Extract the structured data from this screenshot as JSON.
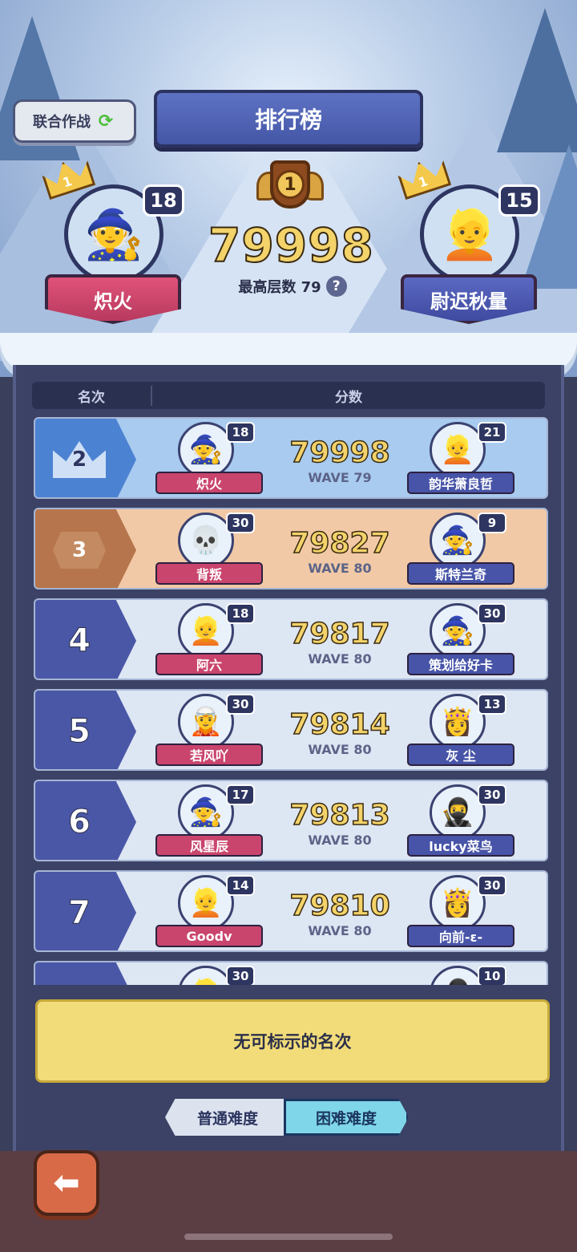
{
  "header": {
    "coop_label": "联合作战",
    "title": "排行榜"
  },
  "top": {
    "rank": "1",
    "score": "79998",
    "floor_label": "最高层数 79",
    "left": {
      "name": "炽火",
      "level": "18",
      "crown": "1",
      "avatar": "🧙"
    },
    "right": {
      "name": "尉迟秋量",
      "level": "15",
      "crown": "1",
      "avatar": "👱"
    }
  },
  "table": {
    "col_rank": "名次",
    "col_score": "分数",
    "rows": [
      {
        "rank": "2",
        "score": "79998",
        "wave": "WAVE 79",
        "p1": {
          "name": "炽火",
          "level": "18",
          "avatar": "🧙"
        },
        "p2": {
          "name": "韵华萧良哲",
          "level": "21",
          "avatar": "👱"
        }
      },
      {
        "rank": "3",
        "score": "79827",
        "wave": "WAVE 80",
        "p1": {
          "name": "背叛",
          "level": "30",
          "avatar": "💀"
        },
        "p2": {
          "name": "斯特兰奇",
          "level": "9",
          "avatar": "🧙"
        }
      },
      {
        "rank": "4",
        "score": "79817",
        "wave": "WAVE 80",
        "p1": {
          "name": "阿六",
          "level": "18",
          "avatar": "👱"
        },
        "p2": {
          "name": "策划给好卡",
          "level": "30",
          "avatar": "🧙"
        }
      },
      {
        "rank": "5",
        "score": "79814",
        "wave": "WAVE 80",
        "p1": {
          "name": "若风吖",
          "level": "30",
          "avatar": "🧝"
        },
        "p2": {
          "name": "灰 尘",
          "level": "13",
          "avatar": "👸"
        }
      },
      {
        "rank": "6",
        "score": "79813",
        "wave": "WAVE 80",
        "p1": {
          "name": "风星辰",
          "level": "17",
          "avatar": "🧙"
        },
        "p2": {
          "name": "lucky菜鸟",
          "level": "30",
          "avatar": "🥷"
        }
      },
      {
        "rank": "7",
        "score": "79810",
        "wave": "WAVE 80",
        "p1": {
          "name": "Goodv",
          "level": "14",
          "avatar": "👱"
        },
        "p2": {
          "name": "向前-ε-",
          "level": "30",
          "avatar": "👸"
        }
      },
      {
        "rank": "",
        "score": "",
        "wave": "",
        "p1": {
          "name": "",
          "level": "30",
          "avatar": "👱"
        },
        "p2": {
          "name": "",
          "level": "10",
          "avatar": "🥷"
        }
      }
    ]
  },
  "my_rank": "无可标示的名次",
  "difficulty": {
    "normal": "普通难度",
    "hard": "困难难度",
    "selected": "hard"
  },
  "icons": {
    "back": "back-arrow-icon",
    "help": "question-icon",
    "refresh": "refresh-icon"
  },
  "colors": {
    "accent_gold": "#f3d36a",
    "panel": "#3b4265",
    "red_name": "#c9456d",
    "blue_name": "#4754a8"
  }
}
